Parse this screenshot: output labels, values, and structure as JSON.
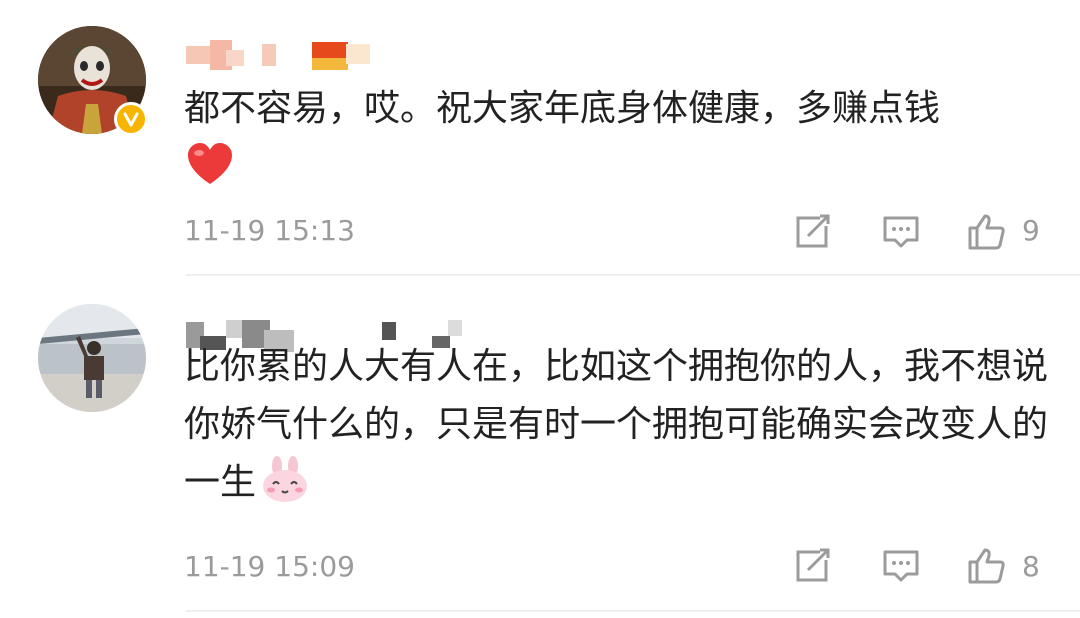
{
  "comments": [
    {
      "text": "都不容易，哎。祝大家年底身体健康，多赚点钱",
      "emoji": "heart",
      "timestamp": "11-19 15:13",
      "like_count": "9",
      "verified": true,
      "colors": {
        "badge": "#f7b500",
        "heart": "#ec3a3a"
      }
    },
    {
      "text": "比你累的人大有人在，比如这个拥抱你的人，我不想说你娇气什么的，只是有时一个拥抱可能确实会改变人的一生",
      "emoji": "rabbit",
      "timestamp": "11-19 15:09",
      "like_count": "8",
      "verified": false
    }
  ],
  "icons": {
    "share": "share-icon",
    "reply": "comment-icon",
    "like": "thumbs-up-icon"
  },
  "colors": {
    "meta": "#9b9b9b",
    "divider": "#eeeeee"
  }
}
